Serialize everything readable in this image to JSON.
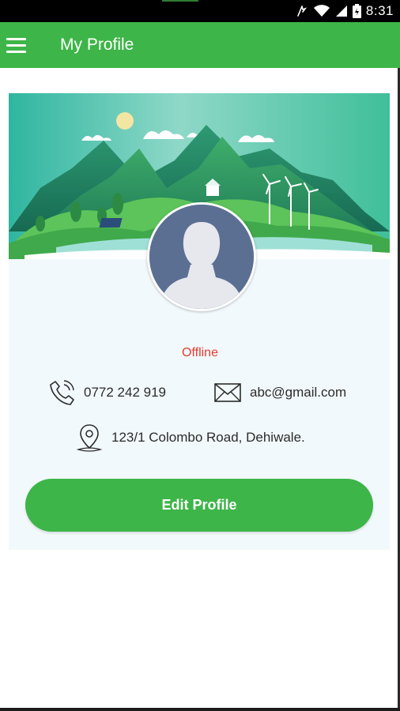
{
  "status_bar": {
    "time": "8:31",
    "icons": [
      "vibrate-icon",
      "wifi-icon",
      "signal-icon",
      "battery-icon"
    ]
  },
  "app_bar": {
    "title": "My Profile",
    "menu_icon": "hamburger-menu-icon",
    "color": "#3db548"
  },
  "profile": {
    "status": "Offline",
    "status_color": "#e53b2e",
    "phone": "0772 242 919",
    "email": "abc@gmail.com",
    "address": "123/1 Colombo Road, Dehiwale."
  },
  "actions": {
    "edit_label": "Edit Profile"
  },
  "colors": {
    "primary": "#3db548",
    "card_background": "#f2f9fc",
    "avatar_background": "#5b6f93"
  }
}
